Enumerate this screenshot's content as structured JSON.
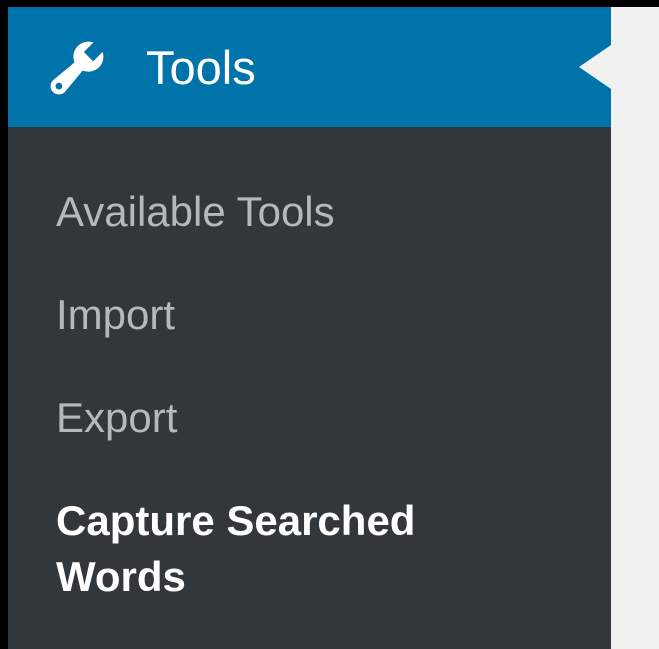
{
  "menu": {
    "title": "Tools",
    "icon": "wrench-icon",
    "accent_color": "#0073aa",
    "sidebar_color": "#32373c",
    "items": [
      {
        "label": "Available Tools",
        "current": false
      },
      {
        "label": "Import",
        "current": false
      },
      {
        "label": "Export",
        "current": false
      },
      {
        "label": "Capture Searched Words",
        "current": true
      }
    ]
  }
}
